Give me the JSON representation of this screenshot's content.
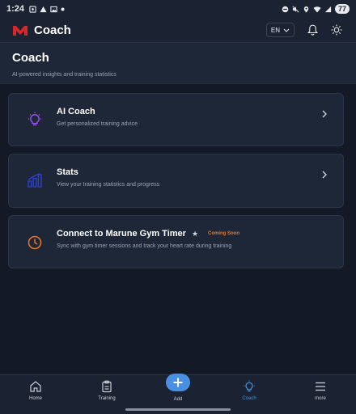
{
  "status_bar": {
    "time": "1:24",
    "battery": "77"
  },
  "header": {
    "app_title": "Coach",
    "language": "EN"
  },
  "page": {
    "title": "Coach",
    "subtitle": "AI-powered insights and training statistics"
  },
  "cards": [
    {
      "title": "AI Coach",
      "description": "Get personalized training advice",
      "icon": "lightbulb-icon",
      "icon_color": "#a855f7"
    },
    {
      "title": "Stats",
      "description": "View your training statistics and progress",
      "icon": "bar-chart-icon",
      "icon_color": "#2f3fd6"
    },
    {
      "title": "Connect to Marune Gym Timer",
      "description": "Sync with gym timer sessions and track your heart rate during training",
      "badge": "Coming Soon",
      "icon": "clock-icon",
      "icon_color": "#e8752a"
    }
  ],
  "bottom_nav": {
    "items": [
      {
        "label": "Home",
        "icon": "home-icon"
      },
      {
        "label": "Training",
        "icon": "clipboard-icon"
      },
      {
        "label": "Add",
        "icon": "plus-icon"
      },
      {
        "label": "Coach",
        "icon": "lightbulb-icon",
        "active": true
      },
      {
        "label": "more",
        "icon": "menu-icon"
      }
    ]
  },
  "colors": {
    "accent": "#4a90e2",
    "badge": "#e8752a",
    "background": "#131a26",
    "card": "#1e2737"
  }
}
